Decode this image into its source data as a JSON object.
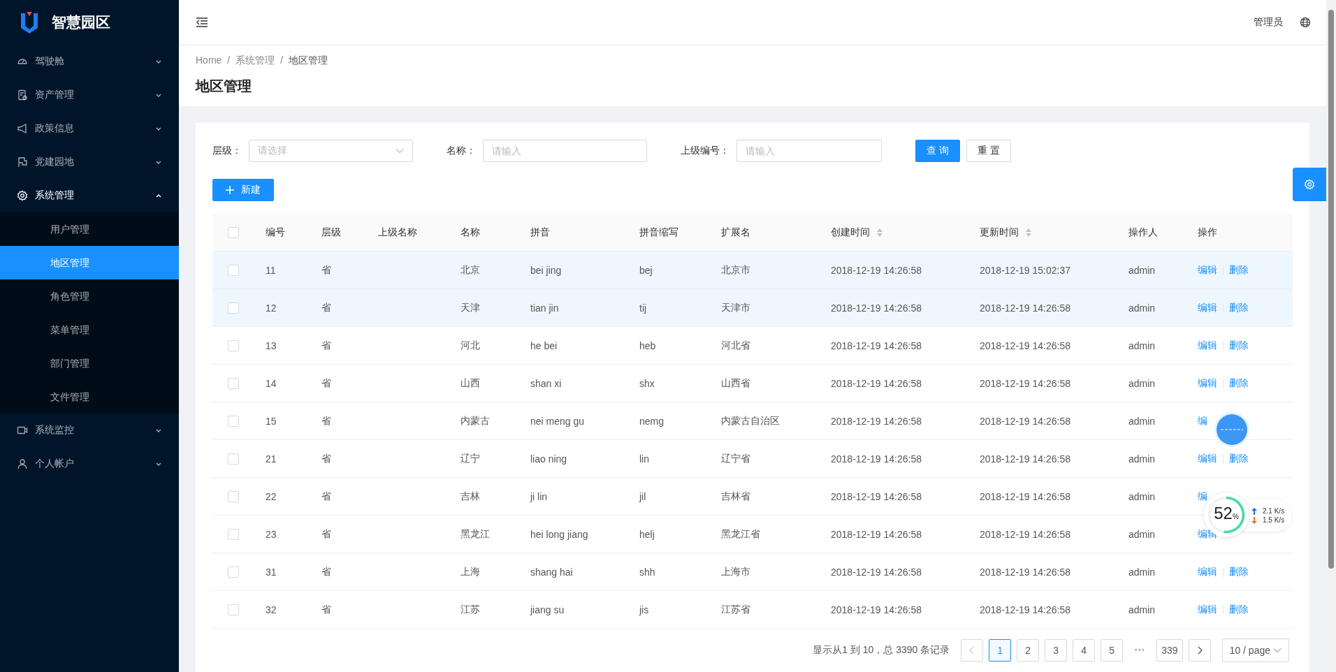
{
  "app": {
    "title": "智慧园区"
  },
  "menu": [
    {
      "label": "驾驶舱",
      "expanded": false
    },
    {
      "label": "资产管理",
      "expanded": false
    },
    {
      "label": "政策信息",
      "expanded": false
    },
    {
      "label": "党建园地",
      "expanded": false
    },
    {
      "label": "系统管理",
      "expanded": true,
      "children": [
        {
          "label": "用户管理",
          "selected": false
        },
        {
          "label": "地区管理",
          "selected": true
        },
        {
          "label": "角色管理",
          "selected": false
        },
        {
          "label": "菜单管理",
          "selected": false
        },
        {
          "label": "部门管理",
          "selected": false
        },
        {
          "label": "文件管理",
          "selected": false
        }
      ]
    },
    {
      "label": "系统监控",
      "expanded": false
    },
    {
      "label": "个人帐户",
      "expanded": false
    }
  ],
  "header": {
    "user": "管理员"
  },
  "breadcrumb": [
    {
      "label": "Home"
    },
    {
      "separator": "/",
      "label": "系统管理"
    },
    {
      "separator": "/",
      "label": "地区管理"
    }
  ],
  "page_title": "地区管理",
  "filters": [
    {
      "kind": "select",
      "label": "层级：",
      "placeholder": "请选择"
    },
    {
      "kind": "input",
      "label": "名称：",
      "placeholder": "请输入"
    },
    {
      "kind": "input",
      "label": "上级编号：",
      "placeholder": "请输入"
    }
  ],
  "buttons": {
    "query": "查 询",
    "reset": "重 置",
    "create": "新建"
  },
  "table": {
    "all_checked": false,
    "columns": [
      {
        "label": "编号",
        "sortable": false
      },
      {
        "label": "层级",
        "sortable": false
      },
      {
        "label": "上级名称",
        "sortable": false
      },
      {
        "label": "名称",
        "sortable": false
      },
      {
        "label": "拼音",
        "sortable": false
      },
      {
        "label": "拼音缩写",
        "sortable": false
      },
      {
        "label": "扩展名",
        "sortable": false
      },
      {
        "label": "创建时间",
        "sortable": true
      },
      {
        "label": "更新时间",
        "sortable": true
      },
      {
        "label": "操作人",
        "sortable": false
      },
      {
        "label": "操作",
        "sortable": false
      }
    ],
    "rows": [
      {
        "selected": true,
        "checked": false,
        "cells": [
          "11",
          "省",
          "",
          "北京",
          "bei jing",
          "bej",
          "北京市",
          "2018-12-19 14:26:58",
          "2018-12-19 15:02:37",
          "admin"
        ],
        "actions": [
          "编辑",
          "删除"
        ]
      },
      {
        "selected": true,
        "checked": false,
        "cells": [
          "12",
          "省",
          "",
          "天津",
          "tian jin",
          "tij",
          "天津市",
          "2018-12-19 14:26:58",
          "2018-12-19 14:26:58",
          "admin"
        ],
        "actions": [
          "编辑",
          "删除"
        ]
      },
      {
        "selected": false,
        "checked": false,
        "cells": [
          "13",
          "省",
          "",
          "河北",
          "he bei",
          "heb",
          "河北省",
          "2018-12-19 14:26:58",
          "2018-12-19 14:26:58",
          "admin"
        ],
        "actions": [
          "编辑",
          "删除"
        ]
      },
      {
        "selected": false,
        "checked": false,
        "cells": [
          "14",
          "省",
          "",
          "山西",
          "shan xi",
          "shx",
          "山西省",
          "2018-12-19 14:26:58",
          "2018-12-19 14:26:58",
          "admin"
        ],
        "actions": [
          "编辑",
          "删除"
        ]
      },
      {
        "selected": false,
        "checked": false,
        "cells": [
          "15",
          "省",
          "",
          "内蒙古",
          "nei meng gu",
          "nemg",
          "内蒙古自治区",
          "2018-12-19 14:26:58",
          "2018-12-19 14:26:58",
          "admin"
        ],
        "actions": [
          "编"
        ]
      },
      {
        "selected": false,
        "checked": false,
        "cells": [
          "21",
          "省",
          "",
          "辽宁",
          "liao ning",
          "lin",
          "辽宁省",
          "2018-12-19 14:26:58",
          "2018-12-19 14:26:58",
          "admin"
        ],
        "actions": [
          "编辑",
          "删除"
        ]
      },
      {
        "selected": false,
        "checked": false,
        "cells": [
          "22",
          "省",
          "",
          "吉林",
          "ji lin",
          "jil",
          "吉林省",
          "2018-12-19 14:26:58",
          "2018-12-19 14:26:58",
          "admin"
        ],
        "actions": [
          "编"
        ]
      },
      {
        "selected": false,
        "checked": false,
        "cells": [
          "23",
          "省",
          "",
          "黑龙江",
          "hei long jiang",
          "helj",
          "黑龙江省",
          "2018-12-19 14:26:58",
          "2018-12-19 14:26:58",
          "admin"
        ],
        "actions": [
          "编辑"
        ]
      },
      {
        "selected": false,
        "checked": false,
        "cells": [
          "31",
          "省",
          "",
          "上海",
          "shang hai",
          "shh",
          "上海市",
          "2018-12-19 14:26:58",
          "2018-12-19 14:26:58",
          "admin"
        ],
        "actions": [
          "编辑",
          "删除"
        ]
      },
      {
        "selected": false,
        "checked": false,
        "cells": [
          "32",
          "省",
          "",
          "江苏",
          "jiang su",
          "jis",
          "江苏省",
          "2018-12-19 14:26:58",
          "2018-12-19 14:26:58",
          "admin"
        ],
        "actions": [
          "编辑",
          "删除"
        ]
      }
    ]
  },
  "pagination": {
    "summary": "显示从1 到 10，总 3390 条记录",
    "pages": [
      {
        "label": "1",
        "selected": true
      },
      {
        "label": "2",
        "selected": false
      },
      {
        "label": "3",
        "selected": false
      },
      {
        "label": "4",
        "selected": false
      },
      {
        "label": "5",
        "selected": false
      },
      {
        "label": "•••",
        "kind": "ellipsis",
        "selected": false
      },
      {
        "label": "339",
        "selected": false
      }
    ],
    "page_size": "10 / page"
  },
  "network_meter": {
    "percent": "52",
    "unit": "%",
    "level": 0.52,
    "upload": "2.1 K/s",
    "download": "1.5 K/s"
  }
}
